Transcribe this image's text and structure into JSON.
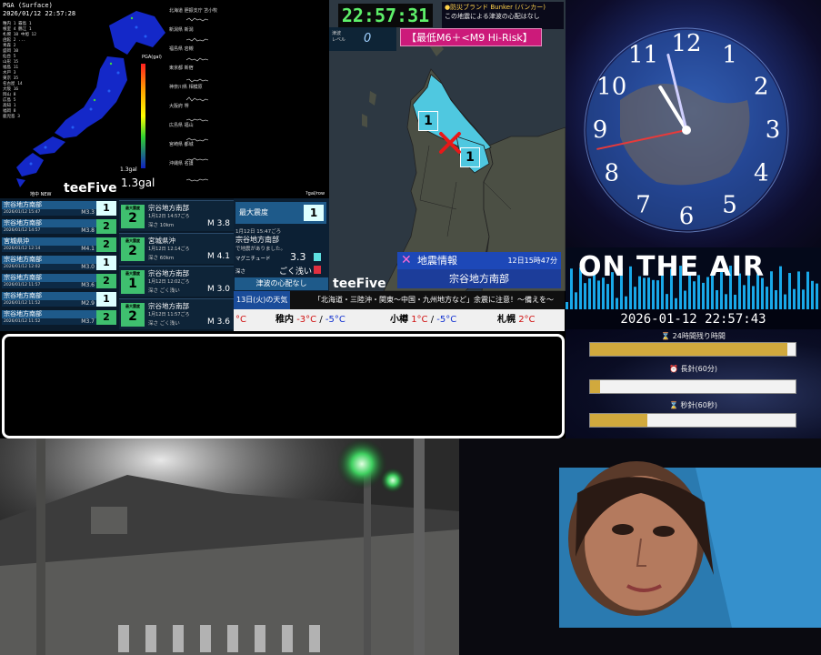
{
  "seismic": {
    "header_line1": "PGA (Surface)",
    "header_line2": "2026/01/12 22:57:28",
    "list": [
      "稚内 1  霧島 1",
      "根室 4  鶴江 1",
      "札幌 18 中旭 12",
      "函館 2  ...",
      "青森 2",
      "盛岡 10",
      "仙台 5",
      "山形 15",
      "福島 11",
      "水戸 3",
      "東京 35",
      "名古屋 14",
      "大阪 16",
      "岡山 8",
      "広島 5",
      "高知 1",
      "福岡 8",
      "鹿児島 3"
    ],
    "scale_title": "PGA(gal)",
    "gal_value": "1.3gal",
    "gal_small": "1.3gal",
    "waveform_stations": [
      "北海道 胆振支庁 苫小牧",
      "新潟県 新潟",
      "福島県 岩槻",
      "東京都 新宿",
      "神奈川県 相模原",
      "大阪府 堺",
      "広島県 福山",
      "宮崎県 都城",
      "沖縄県 名護"
    ],
    "brand": "teeFive",
    "unit_label": "?gal/row",
    "small_label": "地中 NEW"
  },
  "eq_list": [
    {
      "place": "宗谷地方南部",
      "time": "2026/01/12 15:47",
      "mag": "M3.3",
      "intensity": "1"
    },
    {
      "place": "宗谷地方南部",
      "time": "2026/01/12 14:57",
      "mag": "M3.8",
      "intensity": "2"
    },
    {
      "place": "宮城県沖",
      "time": "2026/01/12 12:14",
      "mag": "M4.1",
      "intensity": "2"
    },
    {
      "place": "宗谷地方南部",
      "time": "2026/01/12 12:02",
      "mag": "M3.0",
      "intensity": "1"
    },
    {
      "place": "宗谷地方南部",
      "time": "2026/01/12 11:57",
      "mag": "M3.6",
      "intensity": "2"
    },
    {
      "place": "宗谷地方南部",
      "time": "2026/01/12 11:52",
      "mag": "M2.9",
      "intensity": "1"
    },
    {
      "place": "宗谷地方南部",
      "time": "2026/01/12 11:52",
      "mag": "M3.7",
      "intensity": "2"
    }
  ],
  "eq_cards": [
    {
      "badge_label": "最大震度",
      "intensity": "2",
      "place": "宗谷地方南部",
      "time": "1月12日 14:57ごろ",
      "depth": "深さ 10km",
      "mag": "M 3.8"
    },
    {
      "badge_label": "最大震度",
      "intensity": "2",
      "place": "宮城県沖",
      "time": "1月12日 12:14ごろ",
      "depth": "深さ 60km",
      "mag": "M 4.1"
    },
    {
      "badge_label": "最大震度",
      "intensity": "1",
      "place": "宗谷地方南部",
      "time": "1月12日 12:02ごろ",
      "depth": "深さ ごく浅い",
      "mag": "M 3.0"
    },
    {
      "badge_label": "最大震度",
      "intensity": "2",
      "place": "宗谷地方南部",
      "time": "1月12日 11:57ごろ",
      "depth": "深さ ごく浅い",
      "mag": "M 3.6"
    }
  ],
  "detail": {
    "max_label": "最大震度",
    "max_value": "1",
    "time": "1月12日 15:47ごろ",
    "place": "宗谷地方南部",
    "note": "で地震がありました。",
    "mag_label": "マグニチュード",
    "mag_value": "3.3",
    "depth_label": "深さ",
    "depth_value": "ごく浅い",
    "tsunami": "津波の心配なし"
  },
  "center": {
    "clock": "22:57:31",
    "bunker_title": "●防災ブランド Bunker (バンカー)",
    "bunker_msg": "この地震による津波の心配はなし",
    "tsunami_label": "津波\nレベル",
    "tsunami_value": "0",
    "risk": "【最低M6＋<M9 Hi-Risk】",
    "map_intensities": [
      "1",
      "1"
    ],
    "brand": "teeFive",
    "quake_title": "地震情報",
    "quake_date": "12日15時47分",
    "quake_place": "宗谷地方南部"
  },
  "ticker": {
    "date": "13日(火)の天気",
    "message": "「北海道・三陸沖・関東〜中国・九州地方など」余震に注意！〜備えを〜"
  },
  "weather": [
    {
      "city": "",
      "hi": "°C",
      "lo": ""
    },
    {
      "city": "稚内",
      "hi": "-3°C",
      "lo": "-5°C"
    },
    {
      "city": "小樽",
      "hi": "1°C",
      "lo": "-5°C"
    },
    {
      "city": "札幌",
      "hi": "2°C",
      "lo": ""
    }
  ],
  "analog_clock": {
    "numerals": [
      "12",
      "1",
      "2",
      "3",
      "4",
      "5",
      "6",
      "7",
      "8",
      "9",
      "10",
      "11"
    ],
    "hour": 22,
    "minute": 57,
    "second": 43
  },
  "onair": {
    "title": "ON THE AIR",
    "timestamp": "2026-01-12 22:57:43"
  },
  "progress": [
    {
      "label": "24時間残り時間",
      "icon": "hourglass-icon",
      "fraction": 0.96
    },
    {
      "label": "長針(60分)",
      "icon": "clock-icon",
      "fraction": 0.05
    },
    {
      "label": "秒針(60秒)",
      "icon": "hourglass-icon",
      "fraction": 0.28
    }
  ],
  "colors": {
    "intensity1": "#ddffff",
    "intensity2": "#3fbf6f",
    "risk": "#cc1a7a",
    "digital_clock": "#5ef06a",
    "progress_fill": "#d1a93d"
  }
}
